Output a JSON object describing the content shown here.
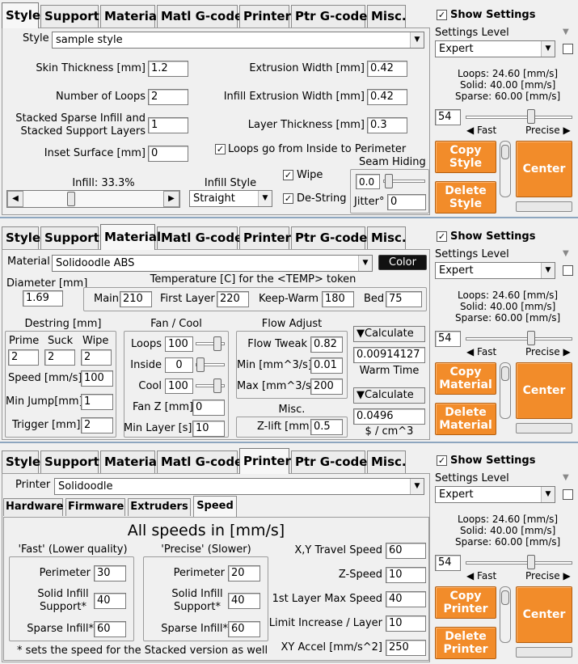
{
  "tabs": [
    "Style",
    "Support",
    "Material",
    "Matl G-code",
    "Printer",
    "Ptr G-code",
    "Misc."
  ],
  "right_panel": {
    "show_settings": "Show Settings",
    "settings_level_label": "Settings Level",
    "settings_level_value": "Expert",
    "loops": "Loops:  24.60 [mm/s]",
    "solid": "Solid:  40.00 [mm/s]",
    "sparse": "Sparse: 60.00 [mm/s]",
    "speed_value": "54",
    "speed_percent": 0.62,
    "fast": "Fast",
    "precise": "Precise",
    "center": "Center"
  },
  "style_panel": {
    "copy": "Copy Style",
    "delete": "Delete Style",
    "style_label": "Style",
    "style_value": "sample style",
    "skin_thickness_label": "Skin Thickness [mm]",
    "skin_thickness": "1.2",
    "extrusion_width_label": "Extrusion Width [mm]",
    "extrusion_width": "0.42",
    "loops_label": "Number of Loops",
    "loops": "2",
    "infill_width_label": "Infill Extrusion Width [mm]",
    "infill_width": "0.42",
    "stacked_label_1": "Stacked Sparse Infill and",
    "stacked_label_2": "Stacked Support Layers",
    "stacked": "1",
    "layer_thickness_label": "Layer Thickness [mm]",
    "layer_thickness": "0.3",
    "inset_label": "Inset  Surface [mm]",
    "inset": "0",
    "inside_perimeter": "Loops go from Inside to Perimeter",
    "infill_label": "Infill: 33.3%",
    "infill_fraction": 0.333,
    "infill_style_label": "Infill Style",
    "infill_style": "Straight",
    "wipe": "Wipe",
    "destring": "De-String",
    "seam_hiding": "Seam Hiding",
    "seam_value": "0.0",
    "jitter_label": "Jitter°",
    "jitter": "0"
  },
  "material_panel": {
    "copy": "Copy Material",
    "delete": "Delete Material",
    "material_label": "Material",
    "material_value": "Solidoodle ABS",
    "color": "Color",
    "diameter_label": "Diameter [mm]",
    "diameter": "1.69",
    "temp_title": "Temperature [C] for the <TEMP> token",
    "main_label": "Main",
    "main": "210",
    "first_layer_label": "First Layer",
    "first_layer": "220",
    "keep_warm_label": "Keep-Warm",
    "keep_warm": "180",
    "bed_label": "Bed",
    "bed": "75",
    "destring_title": "Destring [mm]",
    "prime_label": "Prime",
    "suck_label": "Suck",
    "wipe_label": "Wipe",
    "prime": "2",
    "suck": "2",
    "wipe": "2",
    "speed_label": "Speed [mm/s]",
    "speed": "100",
    "min_jump_label": "Min Jump[mm]",
    "min_jump": "1",
    "trigger_label": "Trigger [mm]",
    "trigger": "2",
    "fan_title": "Fan / Cool",
    "fan_loops_label": "Loops",
    "fan_loops": "100",
    "fan_inside_label": "Inside",
    "fan_inside": "0",
    "fan_cool_label": "Cool",
    "fan_cool": "100",
    "fan_z_label": "Fan Z [mm]",
    "fan_z": "0",
    "min_layer_label": "Min Layer [s]",
    "min_layer": "10",
    "flow_title": "Flow Adjust",
    "flow_tweak_label": "Flow Tweak",
    "flow_tweak": "0.82",
    "min_flow_label": "Min [mm^3/s]",
    "min_flow": "0.01",
    "max_flow_label": "Max [mm^3/s]",
    "max_flow": "200",
    "calculate": "Calculate",
    "warm_time_value": "0.00914127",
    "warm_time_label": "Warm Time",
    "misc_title": "Misc.",
    "zlift_label": "Z-lift [mm]",
    "zlift": "0.5",
    "cost_value": "0.0496",
    "cost_label": "$ / cm^3"
  },
  "printer_panel": {
    "copy": "Copy Printer",
    "delete": "Delete Printer",
    "printer_label": "Printer",
    "printer_value": "Solidoodle",
    "subtabs": [
      "Hardware",
      "Firmware",
      "Extruders",
      "Speed"
    ],
    "all_speeds": "All speeds in [mm/s]",
    "fast_title": "'Fast' (Lower quality)",
    "precise_title": "'Precise' (Slower)",
    "perimeter_label": "Perimeter",
    "solid_label_1": "Solid Infill",
    "solid_label_2": "Support*",
    "sparse_label": "Sparse Infill*",
    "fast_perimeter": "30",
    "fast_solid": "40",
    "fast_sparse": "60",
    "precise_perimeter": "20",
    "precise_solid": "40",
    "precise_sparse": "60",
    "xy_travel_label": "X,Y Travel Speed",
    "xy_travel": "60",
    "z_speed_label": "Z-Speed",
    "z_speed": "10",
    "first_layer_label": "1st Layer Max Speed",
    "first_layer": "40",
    "limit_label": "Limit Increase / Layer",
    "limit": "10",
    "accel_label": "XY Accel [mm/s^2]",
    "accel": "250",
    "footnote": "* sets the speed for the Stacked version as well"
  }
}
